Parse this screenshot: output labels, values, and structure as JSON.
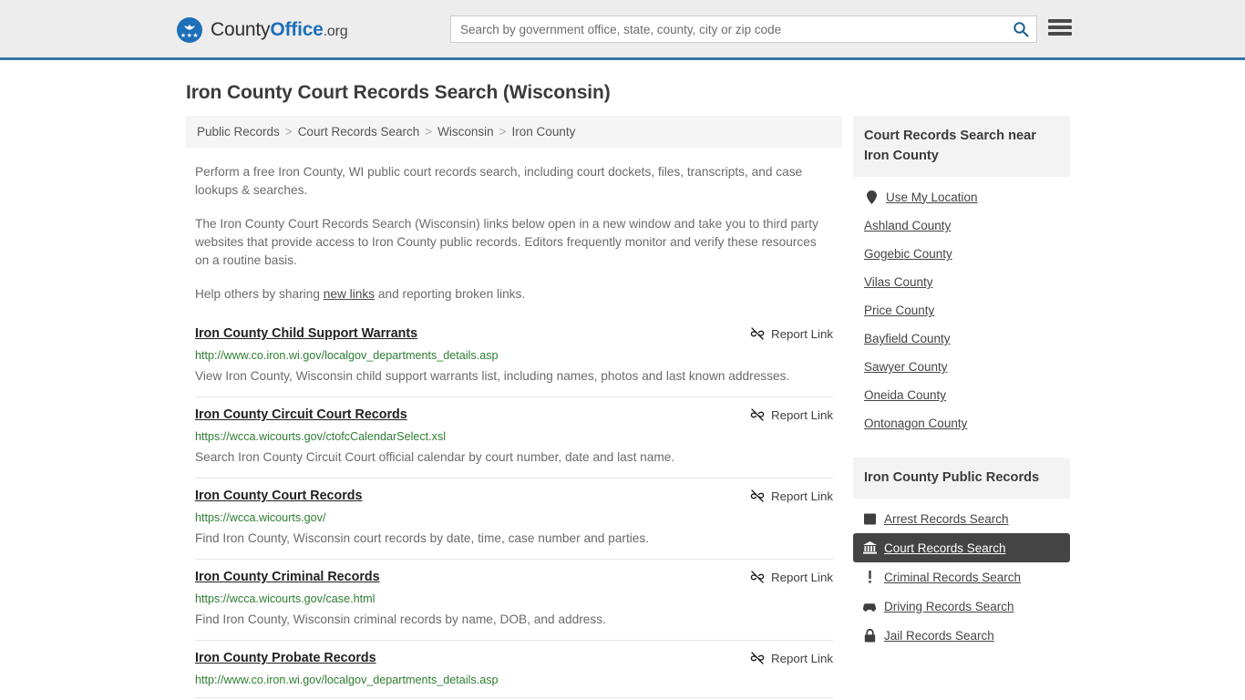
{
  "header": {
    "brand": {
      "part1": "County",
      "part2": "Office",
      "tld": ".org",
      "mark_icon": "eagle-shield-icon",
      "stars": "★★★"
    },
    "search": {
      "placeholder": "Search by government office, state, county, city or zip code",
      "value": "",
      "button_icon": "search-icon"
    },
    "menu_icon": "hamburger-menu-icon",
    "accent_color": "#3577a8"
  },
  "page": {
    "title": "Iron County Court Records Search (Wisconsin)"
  },
  "breadcrumb": {
    "items": [
      "Public Records",
      "Court Records Search",
      "Wisconsin",
      "Iron County"
    ],
    "separator": ">"
  },
  "intro": {
    "p1": "Perform a free Iron County, WI public court records search, including court dockets, files, transcripts, and case lookups & searches.",
    "p2": "The Iron County Court Records Search (Wisconsin) links below open in a new window and take you to third party websites that provide access to Iron County public records. Editors frequently monitor and verify these resources on a routine basis.",
    "p3_before": "Help others by sharing ",
    "p3_link": "new links",
    "p3_after": " and reporting broken links."
  },
  "results": {
    "report_label": "Report Link",
    "report_icon": "broken-link-icon",
    "items": [
      {
        "title": "Iron County Child Support Warrants",
        "url": "http://www.co.iron.wi.gov/localgov_departments_details.asp",
        "desc": "View Iron County, Wisconsin child support warrants list, including names, photos and last known addresses."
      },
      {
        "title": "Iron County Circuit Court Records",
        "url": "https://wcca.wicourts.gov/ctofcCalendarSelect.xsl",
        "desc": "Search Iron County Circuit Court official calendar by court number, date and last name."
      },
      {
        "title": "Iron County Court Records",
        "url": "https://wcca.wicourts.gov/",
        "desc": "Find Iron County, Wisconsin court records by date, time, case number and parties."
      },
      {
        "title": "Iron County Criminal Records",
        "url": "https://wcca.wicourts.gov/case.html",
        "desc": "Find Iron County, Wisconsin criminal records by name, DOB, and address."
      },
      {
        "title": "Iron County Probate Records",
        "url": "http://www.co.iron.wi.gov/localgov_departments_details.asp",
        "desc": ""
      }
    ]
  },
  "sidebar": {
    "nearby": {
      "heading": "Court Records Search near Iron County",
      "items": [
        {
          "label": "Use My Location",
          "icon": "map-pin-icon"
        },
        {
          "label": "Ashland County",
          "icon": ""
        },
        {
          "label": "Gogebic County",
          "icon": ""
        },
        {
          "label": "Vilas County",
          "icon": ""
        },
        {
          "label": "Price County",
          "icon": ""
        },
        {
          "label": "Bayfield County",
          "icon": ""
        },
        {
          "label": "Sawyer County",
          "icon": ""
        },
        {
          "label": "Oneida County",
          "icon": ""
        },
        {
          "label": "Ontonagon County",
          "icon": ""
        }
      ]
    },
    "public_records": {
      "heading": "Iron County Public Records",
      "active_index": 1,
      "active_color": "#444444",
      "items": [
        {
          "label": "Arrest Records Search",
          "icon": "fingerprint-card-icon"
        },
        {
          "label": "Court Records Search",
          "icon": "courthouse-icon"
        },
        {
          "label": "Criminal Records Search",
          "icon": "exclamation-icon"
        },
        {
          "label": "Driving Records Search",
          "icon": "car-icon"
        },
        {
          "label": "Jail Records Search",
          "icon": "padlock-icon"
        }
      ]
    }
  }
}
